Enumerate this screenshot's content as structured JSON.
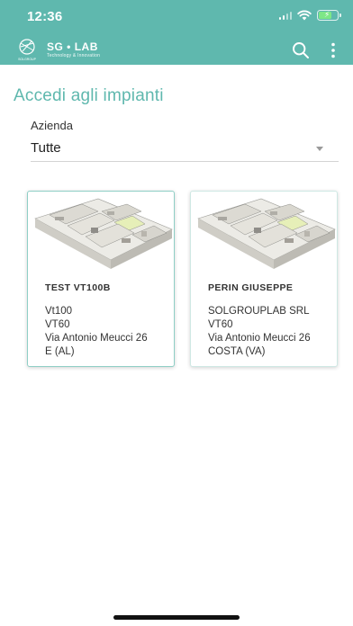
{
  "status_bar": {
    "time": "12:36"
  },
  "header": {
    "brand_title": "SG • LAB",
    "brand_subtitle": "Technology & Innovation",
    "brand_mark_text": "SOLGROUP",
    "icons": [
      "search-icon",
      "more-vert-icon"
    ],
    "accent_color": "#5fb8ae"
  },
  "page": {
    "title": "Accedi agli impianti"
  },
  "filter": {
    "label": "Azienda",
    "value": "Tutte"
  },
  "cards": [
    {
      "title": "TEST VT100B",
      "lines": [
        "Vt100",
        "VT60",
        "Via Antonio Meucci 26",
        "E (AL)"
      ]
    },
    {
      "title": "PERIN GIUSEPPE",
      "lines": [
        "SOLGROUPLAB SRL",
        "VT60",
        "Via Antonio Meucci 26",
        "COSTA (VA)"
      ]
    }
  ]
}
